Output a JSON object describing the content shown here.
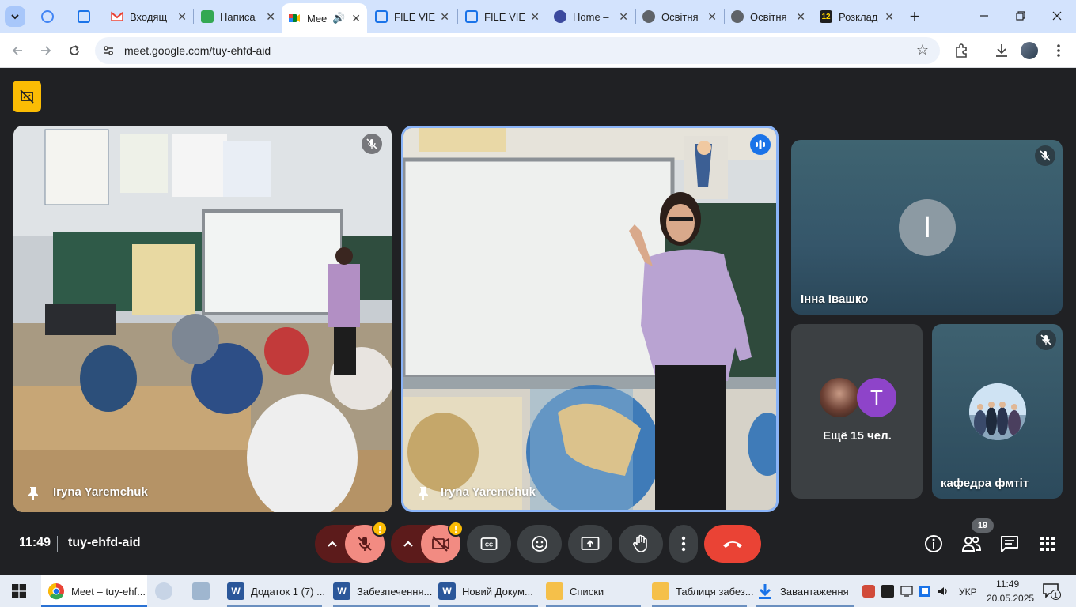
{
  "browser": {
    "tabs": [
      {
        "label": "",
        "color": "#4285f4"
      },
      {
        "label": "",
        "color": "#1a73e8"
      },
      {
        "label": "Входящ",
        "color": "#ea4335"
      },
      {
        "label": "Написа",
        "color": "#34a853"
      },
      {
        "label": "Mee",
        "color": "#00832d"
      },
      {
        "label": "FILE VIE",
        "color": "#1a73e8"
      },
      {
        "label": "FILE VIE",
        "color": "#1a73e8"
      },
      {
        "label": "Home –",
        "color": "#3c4a9e"
      },
      {
        "label": "Освітня",
        "color": "#5f6368"
      },
      {
        "label": "Освітня",
        "color": "#5f6368"
      },
      {
        "label": "Розклад",
        "color": "#1f1f1f",
        "badge": "12"
      }
    ],
    "new_tab_label": "+",
    "address": "meet.google.com/tuy-ehfd-aid"
  },
  "meet": {
    "tiles": [
      {
        "name": "Iryna Yaremchuk"
      },
      {
        "name": "Iryna Yaremchuk"
      },
      {
        "name": "Інна Івашко",
        "initial": "I"
      },
      {
        "name": "Ещё 15 чел.",
        "initial": "T"
      },
      {
        "name": "кафедра фмтіт"
      }
    ],
    "time": "11:49",
    "meeting_code": "tuy-ehfd-aid",
    "warning_mark": "!",
    "participant_count": "19",
    "colors": {
      "end_call": "#ea4335",
      "muted_bg": "#f28b82",
      "avatar_purple": "#8e44c9",
      "badge_yellow": "#fbbc04"
    }
  },
  "taskbar": {
    "items": [
      {
        "label": "Meet – tuy-ehf...",
        "icon": "chrome-icon"
      },
      {
        "label": "",
        "icon": "app-icon-1"
      },
      {
        "label": "",
        "icon": "app-icon-2"
      },
      {
        "label": "Додаток 1 (7) ...",
        "icon": "word-icon"
      },
      {
        "label": "Забезпечення...",
        "icon": "word-icon"
      },
      {
        "label": "Новий Докум...",
        "icon": "word-icon"
      },
      {
        "label": "Списки",
        "icon": "folder-icon"
      },
      {
        "label": "Таблиця забез...",
        "icon": "folder-icon"
      },
      {
        "label": "Завантаження",
        "icon": "download-icon"
      }
    ],
    "lang": "УКР",
    "clock_time": "11:49",
    "clock_date": "20.05.2025",
    "notif_count": "1"
  }
}
